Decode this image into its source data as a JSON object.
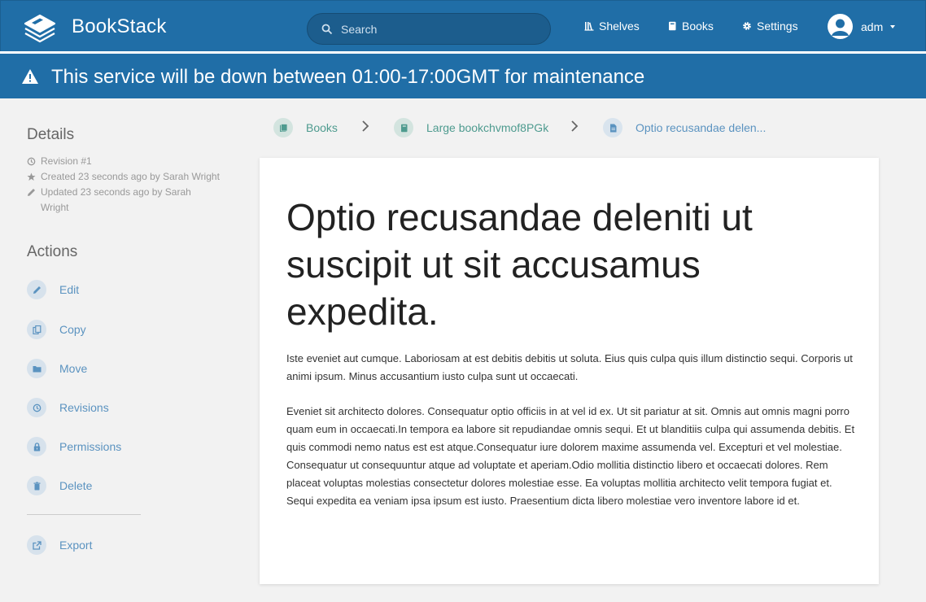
{
  "header": {
    "brand": "BookStack",
    "search_placeholder": "Search",
    "nav": [
      {
        "label": "Shelves",
        "icon": "shelves-icon"
      },
      {
        "label": "Books",
        "icon": "book-icon"
      },
      {
        "label": "Settings",
        "icon": "gear-icon"
      }
    ],
    "user": {
      "name": "adm"
    }
  },
  "banner": {
    "icon": "warning-icon",
    "text": "This service will be down between 01:00-17:00GMT for maintenance"
  },
  "sidebar": {
    "details_heading": "Details",
    "details": [
      {
        "icon": "history-icon",
        "text": "Revision #1"
      },
      {
        "icon": "star-icon",
        "text": "Created 23 seconds ago by Sarah Wright"
      },
      {
        "icon": "pencil-icon",
        "text": "Updated 23 seconds ago by Sarah Wright"
      }
    ],
    "actions_heading": "Actions",
    "actions": [
      {
        "label": "Edit",
        "icon": "edit-icon"
      },
      {
        "label": "Copy",
        "icon": "copy-icon"
      },
      {
        "label": "Move",
        "icon": "folder-icon"
      },
      {
        "label": "Revisions",
        "icon": "history-icon"
      },
      {
        "label": "Permissions",
        "icon": "lock-icon"
      },
      {
        "label": "Delete",
        "icon": "trash-icon"
      }
    ],
    "export_label": "Export"
  },
  "breadcrumb": [
    {
      "label": "Books",
      "icon": "books-icon"
    },
    {
      "label": "Large bookchvmof8PGk",
      "icon": "book-icon"
    },
    {
      "label": "Optio recusandae delen...",
      "icon": "page-icon"
    }
  ],
  "page": {
    "title": "Optio recusandae deleniti ut suscipit ut sit accusamus expedita.",
    "paragraphs": [
      "Iste eveniet aut cumque. Laboriosam at est debitis debitis ut soluta. Eius quis culpa quis illum distinctio sequi. Corporis ut animi ipsum. Minus accusantium iusto culpa sunt ut occaecati.",
      "Eveniet sit architecto dolores. Consequatur optio officiis in at vel id ex. Ut sit pariatur at sit. Omnis aut omnis magni porro quam eum in occaecati.In tempora ea labore sit repudiandae omnis sequi. Et ut blanditiis culpa qui assumenda debitis. Et quis commodi nemo natus est est atque.Consequatur iure dolorem maxime assumenda vel. Excepturi et vel molestiae. Consequatur ut consequuntur atque ad voluptate et aperiam.Odio mollitia distinctio libero et occaecati dolores. Rem placeat voluptas molestias consectetur dolores molestiae esse. Ea voluptas mollitia architecto velit tempora fugiat et. Sequi expedita ea veniam ipsa ipsum est iusto. Praesentium dicta libero molestiae vero inventore labore id et."
    ]
  },
  "colors": {
    "header_bg": "#206ea7",
    "link": "#5b93c0",
    "book_accent": "#077b70",
    "page_accent": "#206ea7"
  }
}
